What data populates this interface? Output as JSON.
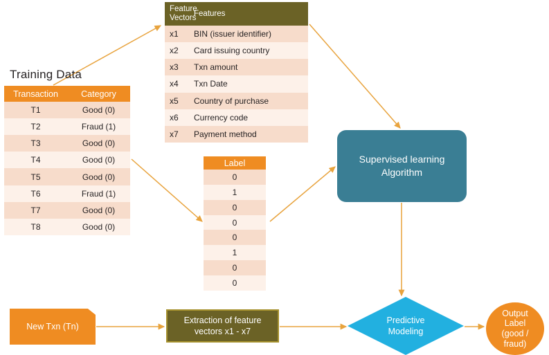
{
  "diagram": {
    "title_training": "Training Data",
    "accent_orange": "#ef8c22",
    "accent_olive": "#6b6226",
    "accent_teal": "#3a7e94",
    "accent_cyan": "#22b0e0",
    "arrow_color": "#e8a33d"
  },
  "training_table": {
    "columns": [
      "Transaction",
      "Category"
    ],
    "rows": [
      [
        "T1",
        "Good (0)"
      ],
      [
        "T2",
        "Fraud (1)"
      ],
      [
        "T3",
        "Good (0)"
      ],
      [
        "T4",
        "Good (0)"
      ],
      [
        "T5",
        "Good (0)"
      ],
      [
        "T6",
        "Fraud (1)"
      ],
      [
        "T7",
        "Good (0)"
      ],
      [
        "T8",
        "Good (0)"
      ]
    ]
  },
  "feature_table": {
    "columns": [
      "Feature\nVectors",
      "Features"
    ],
    "col1_line1": "Feature",
    "col1_line2": "Vectors",
    "col2": "Features",
    "rows": [
      [
        "x1",
        "BIN (issuer identifier)"
      ],
      [
        "x2",
        "Card issuing country"
      ],
      [
        "x3",
        "Txn amount"
      ],
      [
        "x4",
        "Txn Date"
      ],
      [
        "x5",
        "Country of purchase"
      ],
      [
        "x6",
        "Currency code"
      ],
      [
        "x7",
        "Payment method"
      ]
    ]
  },
  "label_table": {
    "column": "Label",
    "values": [
      "0",
      "1",
      "0",
      "0",
      "0",
      "1",
      "0",
      "0"
    ]
  },
  "nodes": {
    "algorithm_line1": "Supervised learning",
    "algorithm_line2": "Algorithm",
    "new_txn": "New Txn (Tn)",
    "extraction_line1": "Extraction of feature",
    "extraction_line2": "vectors x1 - x7",
    "predictive_line1": "Predictive",
    "predictive_line2": "Modeling",
    "output_line1": "Output",
    "output_line2": "Label",
    "output_line3": "(good /",
    "output_line4": "fraud)"
  }
}
